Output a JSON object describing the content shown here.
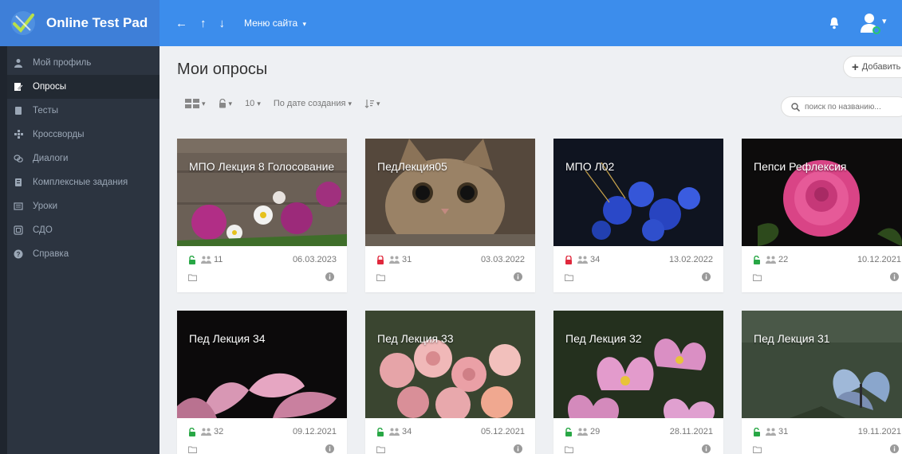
{
  "app": {
    "name": "Online Test Pad",
    "menu_site": "Меню сайта",
    "colors": {
      "brand": "#3e7fd8",
      "navbar": "#3c8dec",
      "sidebar": "#2c3440",
      "unlocked": "#28a745",
      "locked": "#e0283c"
    }
  },
  "nav": {
    "back_icon": "←",
    "up_icon": "↑",
    "down_icon": "↓"
  },
  "sidebar": {
    "items": [
      {
        "label": "Мой профиль",
        "icon": "user-icon",
        "active": false
      },
      {
        "label": "Опросы",
        "icon": "survey-icon",
        "active": true
      },
      {
        "label": "Тесты",
        "icon": "test-icon",
        "active": false
      },
      {
        "label": "Кроссворды",
        "icon": "crossword-icon",
        "active": false
      },
      {
        "label": "Диалоги",
        "icon": "dialog-icon",
        "active": false
      },
      {
        "label": "Комплексные задания",
        "icon": "complex-task-icon",
        "active": false
      },
      {
        "label": "Уроки",
        "icon": "lesson-icon",
        "active": false
      },
      {
        "label": "СДО",
        "icon": "lms-icon",
        "active": false
      },
      {
        "label": "Справка",
        "icon": "help-icon",
        "active": false
      }
    ]
  },
  "main": {
    "title": "Мои опросы",
    "add_label": "Добавить",
    "toolbar": {
      "per_page": "10",
      "sort_label": "По дате создания"
    },
    "search_placeholder": "поиск по названию..."
  },
  "cards": [
    {
      "title": "МПО Лекция 8 Голосование",
      "locked": false,
      "count": "11",
      "date": "06.03.2023",
      "image": "flowers-on-wood"
    },
    {
      "title": "ПедЛекция05",
      "locked": true,
      "count": "31",
      "date": "03.03.2022",
      "image": "cat"
    },
    {
      "title": "МПО Л02",
      "locked": true,
      "count": "34",
      "date": "13.02.2022",
      "image": "blue-flowers"
    },
    {
      "title": "Пепси Рефлексия",
      "locked": false,
      "count": "22",
      "date": "10.12.2021",
      "image": "pink-rose"
    },
    {
      "title": "Пед Лекция 34",
      "locked": false,
      "count": "32",
      "date": "09.12.2021",
      "image": "lilies"
    },
    {
      "title": "Пед Лекция 33",
      "locked": false,
      "count": "34",
      "date": "05.12.2021",
      "image": "roses-bouquet"
    },
    {
      "title": "Пед Лекция 32",
      "locked": false,
      "count": "29",
      "date": "28.11.2021",
      "image": "lotus"
    },
    {
      "title": "Пед Лекция 31",
      "locked": false,
      "count": "31",
      "date": "19.11.2021",
      "image": "butterfly"
    }
  ]
}
